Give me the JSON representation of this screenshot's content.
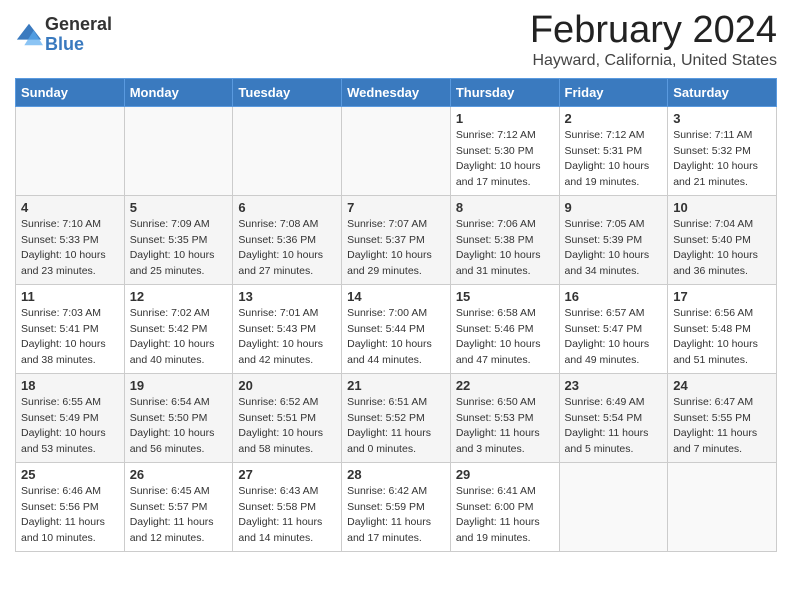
{
  "logo": {
    "general": "General",
    "blue": "Blue"
  },
  "title": "February 2024",
  "subtitle": "Hayward, California, United States",
  "days_header": [
    "Sunday",
    "Monday",
    "Tuesday",
    "Wednesday",
    "Thursday",
    "Friday",
    "Saturday"
  ],
  "weeks": [
    [
      {
        "day": "",
        "detail": ""
      },
      {
        "day": "",
        "detail": ""
      },
      {
        "day": "",
        "detail": ""
      },
      {
        "day": "",
        "detail": ""
      },
      {
        "day": "1",
        "detail": "Sunrise: 7:12 AM\nSunset: 5:30 PM\nDaylight: 10 hours and 17 minutes."
      },
      {
        "day": "2",
        "detail": "Sunrise: 7:12 AM\nSunset: 5:31 PM\nDaylight: 10 hours and 19 minutes."
      },
      {
        "day": "3",
        "detail": "Sunrise: 7:11 AM\nSunset: 5:32 PM\nDaylight: 10 hours and 21 minutes."
      }
    ],
    [
      {
        "day": "4",
        "detail": "Sunrise: 7:10 AM\nSunset: 5:33 PM\nDaylight: 10 hours and 23 minutes."
      },
      {
        "day": "5",
        "detail": "Sunrise: 7:09 AM\nSunset: 5:35 PM\nDaylight: 10 hours and 25 minutes."
      },
      {
        "day": "6",
        "detail": "Sunrise: 7:08 AM\nSunset: 5:36 PM\nDaylight: 10 hours and 27 minutes."
      },
      {
        "day": "7",
        "detail": "Sunrise: 7:07 AM\nSunset: 5:37 PM\nDaylight: 10 hours and 29 minutes."
      },
      {
        "day": "8",
        "detail": "Sunrise: 7:06 AM\nSunset: 5:38 PM\nDaylight: 10 hours and 31 minutes."
      },
      {
        "day": "9",
        "detail": "Sunrise: 7:05 AM\nSunset: 5:39 PM\nDaylight: 10 hours and 34 minutes."
      },
      {
        "day": "10",
        "detail": "Sunrise: 7:04 AM\nSunset: 5:40 PM\nDaylight: 10 hours and 36 minutes."
      }
    ],
    [
      {
        "day": "11",
        "detail": "Sunrise: 7:03 AM\nSunset: 5:41 PM\nDaylight: 10 hours and 38 minutes."
      },
      {
        "day": "12",
        "detail": "Sunrise: 7:02 AM\nSunset: 5:42 PM\nDaylight: 10 hours and 40 minutes."
      },
      {
        "day": "13",
        "detail": "Sunrise: 7:01 AM\nSunset: 5:43 PM\nDaylight: 10 hours and 42 minutes."
      },
      {
        "day": "14",
        "detail": "Sunrise: 7:00 AM\nSunset: 5:44 PM\nDaylight: 10 hours and 44 minutes."
      },
      {
        "day": "15",
        "detail": "Sunrise: 6:58 AM\nSunset: 5:46 PM\nDaylight: 10 hours and 47 minutes."
      },
      {
        "day": "16",
        "detail": "Sunrise: 6:57 AM\nSunset: 5:47 PM\nDaylight: 10 hours and 49 minutes."
      },
      {
        "day": "17",
        "detail": "Sunrise: 6:56 AM\nSunset: 5:48 PM\nDaylight: 10 hours and 51 minutes."
      }
    ],
    [
      {
        "day": "18",
        "detail": "Sunrise: 6:55 AM\nSunset: 5:49 PM\nDaylight: 10 hours and 53 minutes."
      },
      {
        "day": "19",
        "detail": "Sunrise: 6:54 AM\nSunset: 5:50 PM\nDaylight: 10 hours and 56 minutes."
      },
      {
        "day": "20",
        "detail": "Sunrise: 6:52 AM\nSunset: 5:51 PM\nDaylight: 10 hours and 58 minutes."
      },
      {
        "day": "21",
        "detail": "Sunrise: 6:51 AM\nSunset: 5:52 PM\nDaylight: 11 hours and 0 minutes."
      },
      {
        "day": "22",
        "detail": "Sunrise: 6:50 AM\nSunset: 5:53 PM\nDaylight: 11 hours and 3 minutes."
      },
      {
        "day": "23",
        "detail": "Sunrise: 6:49 AM\nSunset: 5:54 PM\nDaylight: 11 hours and 5 minutes."
      },
      {
        "day": "24",
        "detail": "Sunrise: 6:47 AM\nSunset: 5:55 PM\nDaylight: 11 hours and 7 minutes."
      }
    ],
    [
      {
        "day": "25",
        "detail": "Sunrise: 6:46 AM\nSunset: 5:56 PM\nDaylight: 11 hours and 10 minutes."
      },
      {
        "day": "26",
        "detail": "Sunrise: 6:45 AM\nSunset: 5:57 PM\nDaylight: 11 hours and 12 minutes."
      },
      {
        "day": "27",
        "detail": "Sunrise: 6:43 AM\nSunset: 5:58 PM\nDaylight: 11 hours and 14 minutes."
      },
      {
        "day": "28",
        "detail": "Sunrise: 6:42 AM\nSunset: 5:59 PM\nDaylight: 11 hours and 17 minutes."
      },
      {
        "day": "29",
        "detail": "Sunrise: 6:41 AM\nSunset: 6:00 PM\nDaylight: 11 hours and 19 minutes."
      },
      {
        "day": "",
        "detail": ""
      },
      {
        "day": "",
        "detail": ""
      }
    ]
  ]
}
